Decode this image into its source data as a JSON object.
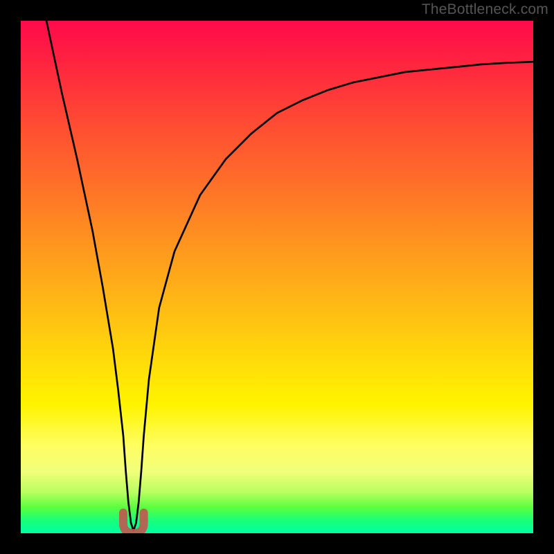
{
  "watermark": "TheBottleneck.com",
  "chart_data": {
    "type": "line",
    "title": "",
    "xlabel": "",
    "ylabel": "",
    "xlim": [
      0,
      100
    ],
    "ylim": [
      0,
      100
    ],
    "series": [
      {
        "name": "curve",
        "x": [
          5,
          8,
          11,
          14,
          16,
          18,
          19,
          20,
          20.5,
          21,
          21.5,
          22,
          22.5,
          23,
          23.5,
          24,
          25,
          27,
          30,
          35,
          40,
          45,
          50,
          55,
          60,
          65,
          70,
          75,
          80,
          85,
          90,
          95,
          100
        ],
        "y": [
          100,
          86,
          73,
          59,
          48,
          36,
          28,
          19,
          12,
          6,
          2,
          0.5,
          2,
          6,
          12,
          19,
          30,
          44,
          55,
          66,
          73,
          78,
          82,
          84.5,
          86.5,
          88,
          89,
          90,
          90.5,
          91,
          91.5,
          91.8,
          92
        ]
      }
    ],
    "annotations": [
      {
        "type": "marker-u-shape",
        "x_range": [
          20,
          24
        ],
        "y_range": [
          0,
          4
        ],
        "color": "#c0594f"
      }
    ]
  }
}
